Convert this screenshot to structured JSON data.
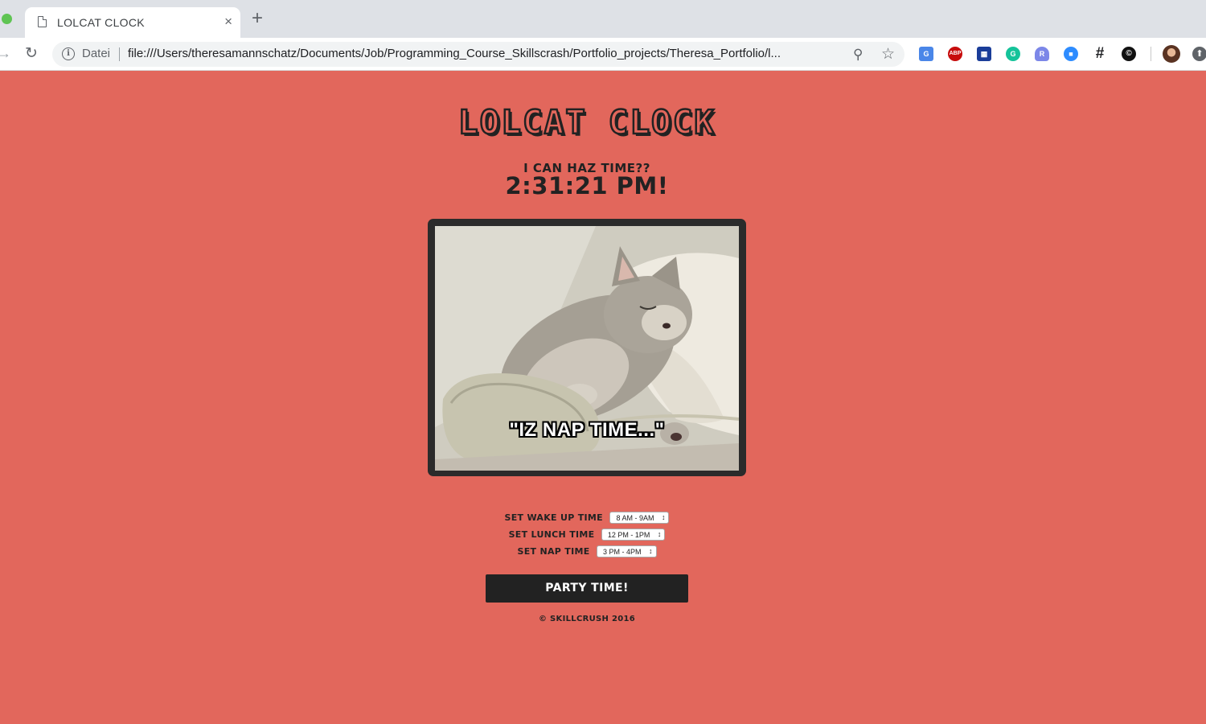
{
  "browser": {
    "tab_title": "LOLCAT CLOCK",
    "tab_close": "×",
    "new_tab": "+",
    "omnibox_label": "Datei",
    "url": "file:///Users/theresamannschatz/Documents/Job/Programming_Course_Skillscrash/Portfolio_projects/Theresa_Portfolio/l...",
    "extensions": [
      {
        "name": "google-translate-icon",
        "glyph": "G"
      },
      {
        "name": "adblock-plus-icon",
        "glyph": "ABP"
      },
      {
        "name": "grid-extension-icon",
        "glyph": "▦"
      },
      {
        "name": "grammarly-icon",
        "glyph": "G"
      },
      {
        "name": "r-extension-icon",
        "glyph": "R"
      },
      {
        "name": "zoom-icon",
        "glyph": "■"
      },
      {
        "name": "hashtag-icon",
        "glyph": "#"
      },
      {
        "name": "copyright-extension-icon",
        "glyph": "©"
      }
    ]
  },
  "page": {
    "title": "LOLCAT CLOCK",
    "tagline": "I CAN HAZ TIME??",
    "time": "2:31:21 PM!",
    "caption": "\"IZ NAP TIME...\"",
    "settings": [
      {
        "label": "SET WAKE UP TIME",
        "value": "8 AM - 9AM"
      },
      {
        "label": "SET LUNCH TIME",
        "value": "12 PM - 1PM"
      },
      {
        "label": "SET NAP TIME",
        "value": "3 PM - 4PM"
      }
    ],
    "party_button": "PARTY TIME!",
    "footer": "© SKILLCRUSH 2016"
  },
  "colors": {
    "background": "#e2675c",
    "dark": "#222222",
    "frame": "#2b2b2b"
  }
}
